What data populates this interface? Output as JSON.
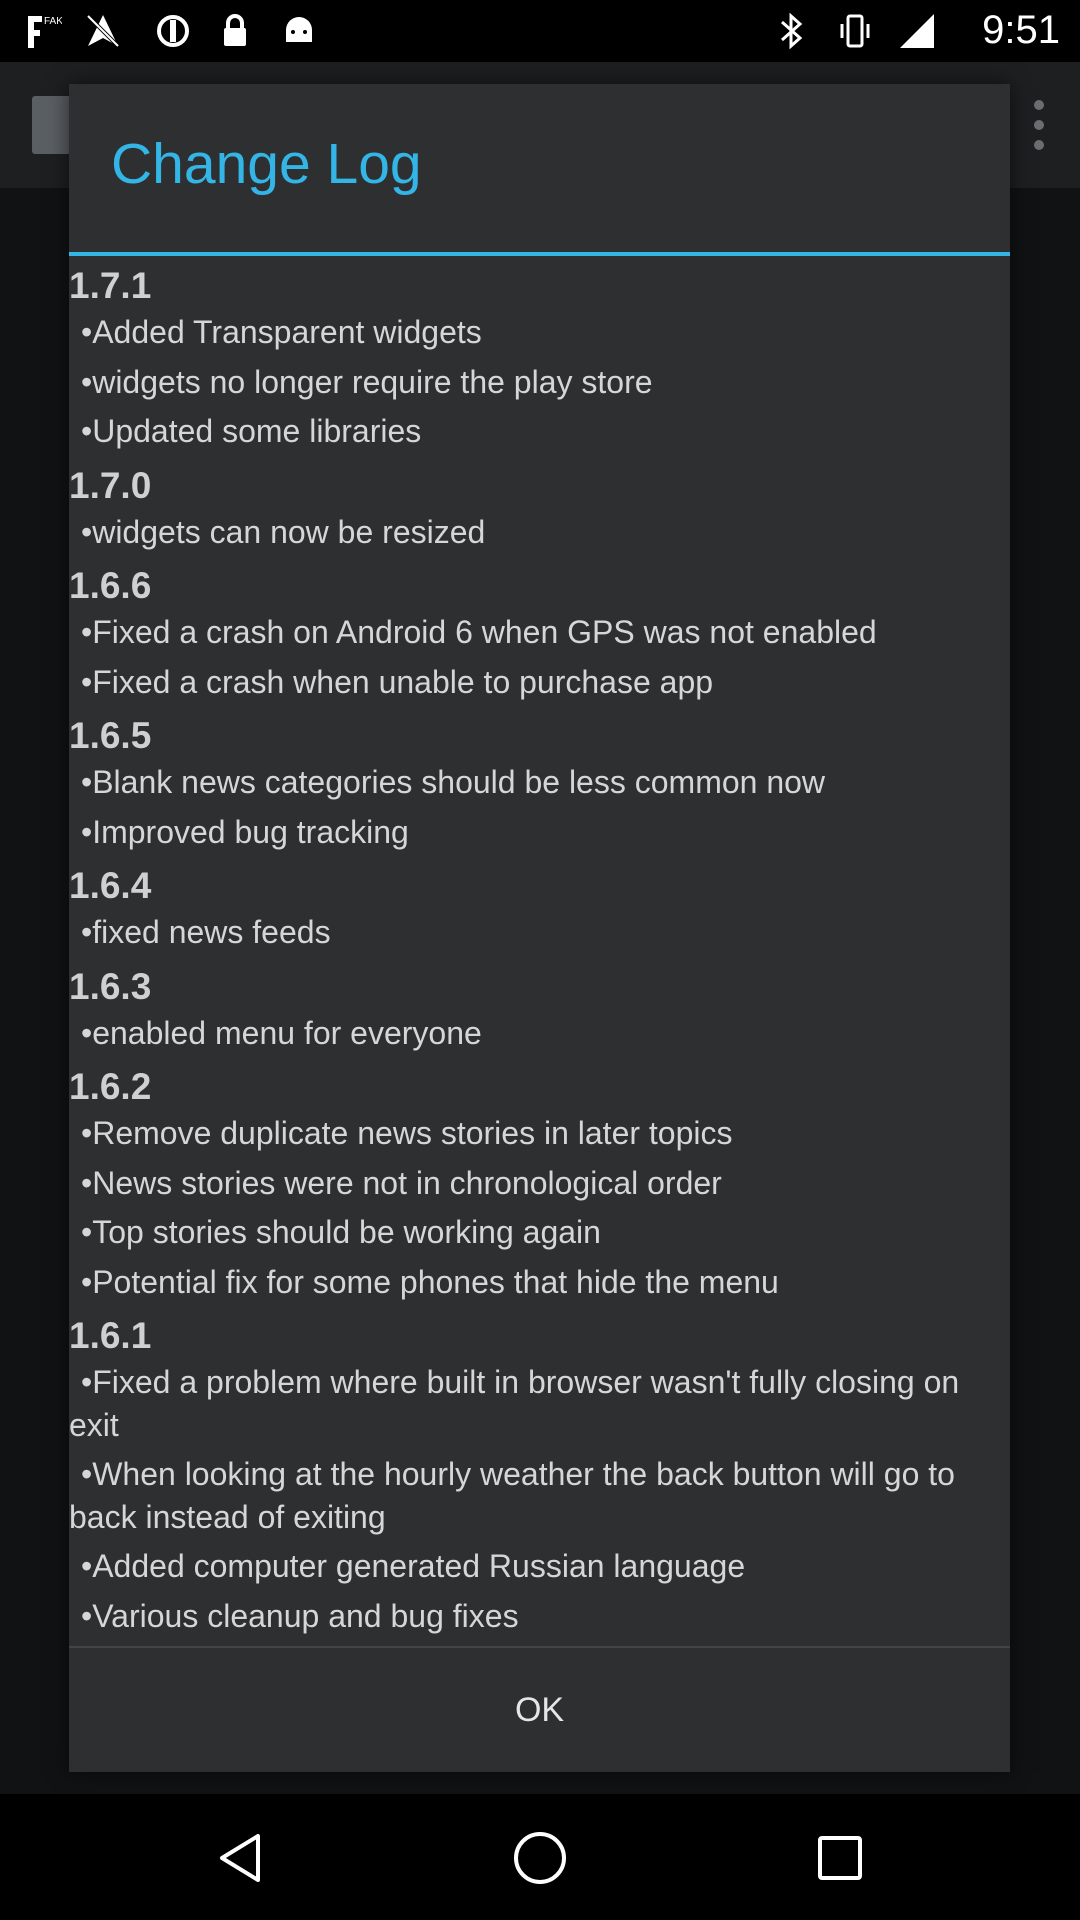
{
  "status_bar": {
    "time": "9:51",
    "left_icons": [
      "fake-gps-icon",
      "no-gps-icon",
      "sync-icon",
      "lock-icon",
      "android-icon"
    ],
    "right_icons": [
      "bluetooth-icon",
      "vibrate-icon",
      "cellular-signal-icon"
    ]
  },
  "dialog": {
    "title": "Change Log",
    "ok_label": "OK",
    "accent_color": "#33b5e5",
    "entries": [
      {
        "version": "1.7.1",
        "items": [
          "•Added Transparent widgets",
          "•widgets no longer require the play store",
          "•Updated some libraries"
        ]
      },
      {
        "version": "1.7.0",
        "items": [
          "•widgets can now be resized"
        ]
      },
      {
        "version": "1.6.6",
        "items": [
          "•Fixed a crash on Android 6 when GPS was not enabled",
          "•Fixed a crash when unable to purchase app"
        ]
      },
      {
        "version": "1.6.5",
        "items": [
          "•Blank news categories should be less common now",
          "•Improved bug tracking"
        ]
      },
      {
        "version": "1.6.4",
        "items": [
          "•fixed news feeds"
        ]
      },
      {
        "version": "1.6.3",
        "items": [
          "•enabled menu for everyone"
        ]
      },
      {
        "version": "1.6.2",
        "items": [
          "•Remove duplicate news stories in later topics",
          "•News stories were not in chronological order",
          "•Top stories should be working again",
          "•Potential fix for some phones that hide the menu"
        ]
      },
      {
        "version": "1.6.1",
        "items": [
          "•Fixed a problem where built in browser wasn't fully closing on exit",
          "•When looking at the hourly weather the back button will go to back instead of exiting",
          "•Added computer generated Russian language",
          "•Various cleanup and bug fixes"
        ]
      }
    ]
  },
  "nav_bar": {
    "buttons": [
      "back-icon",
      "home-icon",
      "recents-icon"
    ]
  }
}
